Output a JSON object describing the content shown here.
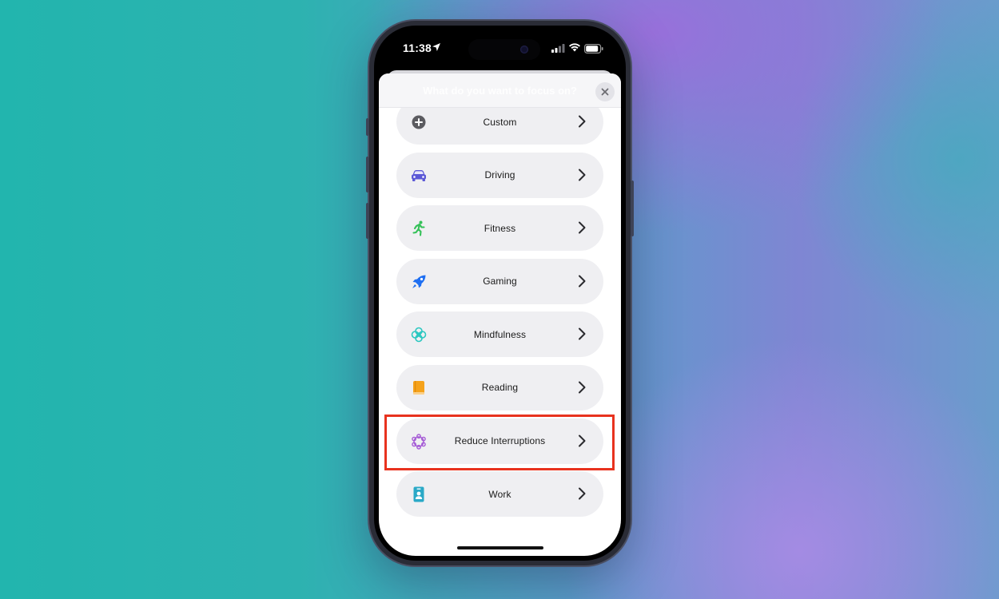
{
  "status_bar": {
    "time": "11:38",
    "icons": [
      "location-arrow-icon",
      "cellular-signal-icon",
      "wifi-icon",
      "battery-icon"
    ]
  },
  "sheet": {
    "title": "What do you want to focus on?",
    "close_icon": "close-icon"
  },
  "focus_options": [
    {
      "label": "Custom",
      "icon": "plus-circle-icon",
      "color": "#5b5b60"
    },
    {
      "label": "Driving",
      "icon": "car-icon",
      "color": "#5a57d6"
    },
    {
      "label": "Fitness",
      "icon": "running-figure-icon",
      "color": "#35c159"
    },
    {
      "label": "Gaming",
      "icon": "rocket-icon",
      "color": "#1f6ff2"
    },
    {
      "label": "Mindfulness",
      "icon": "flower-icon",
      "color": "#2bc7c0"
    },
    {
      "label": "Reading",
      "icon": "book-icon",
      "color": "#f5a21b"
    },
    {
      "label": "Reduce Interruptions",
      "icon": "interruption-flower-icon",
      "color": "#a55bd6"
    },
    {
      "label": "Work",
      "icon": "id-badge-icon",
      "color": "#2aa9c7"
    }
  ],
  "highlighted_option": "Reduce Interruptions",
  "highlight_color": "#e8321e"
}
